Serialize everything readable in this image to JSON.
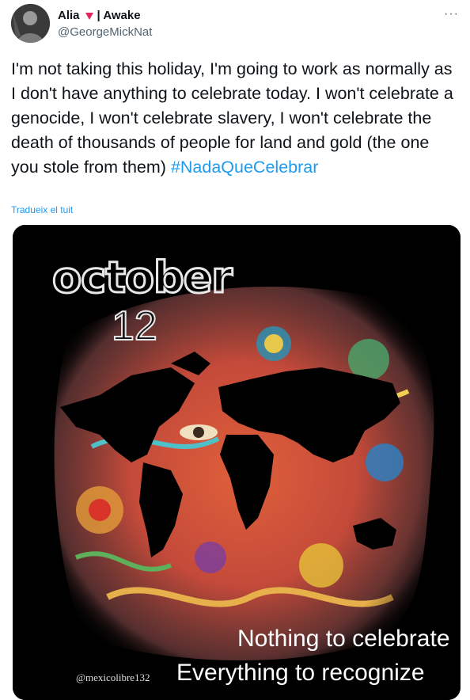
{
  "user": {
    "display_name": "Alia",
    "status": "| Awake",
    "handle": "@GeorgeMickNat",
    "more_label": "···"
  },
  "tweet": {
    "body": "I'm not taking this holiday, I'm going to work as normally as I don't have anything to celebrate today. I won't celebrate a genocide, I won't celebrate slavery, I won't celebrate the death of thousands of people for land and gold (the one you stole from them) ",
    "hashtag": "#NadaQueCelebrar",
    "translate_label": "Tradueix el tuit"
  },
  "image": {
    "headline": "october",
    "date_number": "12",
    "line1": "Nothing to celebrate",
    "line2": "Everything to recognize",
    "credit": "@mexicolibre132"
  },
  "colors": {
    "text": "#0f1419",
    "secondary": "#536471",
    "link": "#1d9bf0",
    "heart": "#e0245e"
  }
}
